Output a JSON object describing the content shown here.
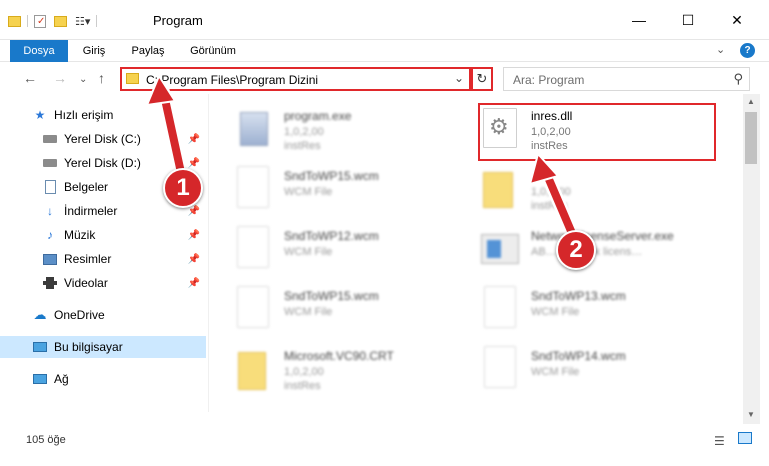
{
  "window": {
    "title": "Program",
    "minimize": "—",
    "maximize": "☐",
    "close": "✕"
  },
  "ribbon": {
    "tabs": [
      {
        "label": "Dosya",
        "active": true
      },
      {
        "label": "Giriş",
        "active": false
      },
      {
        "label": "Paylaş",
        "active": false
      },
      {
        "label": "Görünüm",
        "active": false
      }
    ],
    "expand_icon": "chevron-down-icon",
    "help_icon": "help-icon"
  },
  "address": {
    "path": "C:\\Program Files\\Program Dizini",
    "search_placeholder": "Ara: Program"
  },
  "sidebar": {
    "items": [
      {
        "label": "Hızlı erişim",
        "icon": "star-icon",
        "pinned": false
      },
      {
        "label": "Yerel Disk (C:)",
        "icon": "drive-icon",
        "pinned": true
      },
      {
        "label": "Yerel Disk (D:)",
        "icon": "drive-icon",
        "pinned": true
      },
      {
        "label": "Belgeler",
        "icon": "documents-icon",
        "pinned": true
      },
      {
        "label": "İndirmeler",
        "icon": "download-icon",
        "pinned": true
      },
      {
        "label": "Müzik",
        "icon": "music-icon",
        "pinned": true
      },
      {
        "label": "Resimler",
        "icon": "pictures-icon",
        "pinned": true
      },
      {
        "label": "Videolar",
        "icon": "video-icon",
        "pinned": true
      },
      {
        "label": "OneDrive",
        "icon": "cloud-icon",
        "pinned": false
      },
      {
        "label": "Bu bilgisayar",
        "icon": "computer-icon",
        "pinned": false,
        "selected": true
      },
      {
        "label": "Ağ",
        "icon": "network-icon",
        "pinned": false
      }
    ]
  },
  "files": [
    {
      "name": "program.exe",
      "line2": "1,0,2,00",
      "line3": "instRes",
      "blurred": true,
      "kind": "exe"
    },
    {
      "name": "inres.dll",
      "line2": "1,0,2,00",
      "line3": "instRes",
      "blurred": false,
      "kind": "dll"
    },
    {
      "name": "SndToWP15.wcm",
      "line2": "WCM File",
      "line3": "",
      "blurred": true,
      "kind": "file"
    },
    {
      "name": "…",
      "line2": "1,0,2,00",
      "line3": "instRes",
      "blurred": true,
      "kind": "folder"
    },
    {
      "name": "SndToWP12.wcm",
      "line2": "WCM File",
      "line3": "",
      "blurred": true,
      "kind": "file"
    },
    {
      "name": "NetworkLicenseServer.exe",
      "line2": "AB… Network licens…",
      "line3": "",
      "blurred": true,
      "kind": "app"
    },
    {
      "name": "SndToWP15.wcm",
      "line2": "WCM File",
      "line3": "",
      "blurred": true,
      "kind": "file"
    },
    {
      "name": "SndToWP13.wcm",
      "line2": "WCM File",
      "line3": "",
      "blurred": true,
      "kind": "file"
    },
    {
      "name": "Microsoft.VC90.CRT",
      "line2": "1,0,2,00",
      "line3": "instRes",
      "blurred": true,
      "kind": "folder"
    },
    {
      "name": "SndToWP14.wcm",
      "line2": "WCM File",
      "line3": "",
      "blurred": true,
      "kind": "file"
    }
  ],
  "status": {
    "count": "105 öğe"
  },
  "annotations": [
    {
      "label": "1"
    },
    {
      "label": "2"
    }
  ],
  "colors": {
    "accent": "#1979ca",
    "highlight": "#e0282b",
    "selected": "#cce8ff"
  }
}
